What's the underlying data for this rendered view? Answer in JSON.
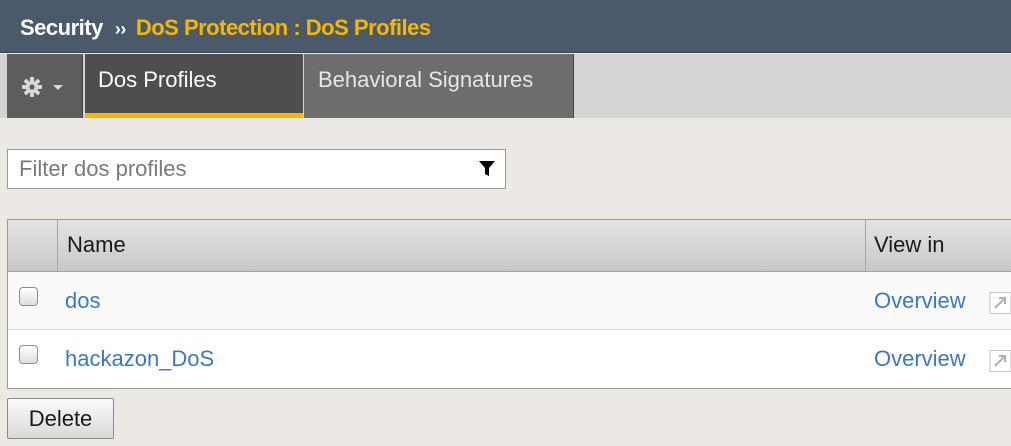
{
  "header": {
    "root": "Security",
    "separator": "››",
    "current": "DoS Protection : DoS Profiles"
  },
  "tabs": [
    {
      "label": "Dos Profiles",
      "active": true
    },
    {
      "label": "Behavioral Signatures",
      "active": false
    }
  ],
  "filter": {
    "placeholder": "Filter dos profiles",
    "value": ""
  },
  "table": {
    "columns": [
      "",
      "Name",
      "View in"
    ],
    "rows": [
      {
        "name": "dos",
        "view_in": "Overview"
      },
      {
        "name": "hackazon_DoS",
        "view_in": "Overview"
      }
    ]
  },
  "actions": {
    "delete_label": "Delete"
  },
  "icons": {
    "gear": "gear-icon",
    "dropdown": "chevron-down-icon",
    "filter": "funnel-icon",
    "external": "external-link-icon"
  },
  "colors": {
    "header_bg": "#4b5a6b",
    "accent": "#f5b800",
    "link": "#3a78c4"
  }
}
